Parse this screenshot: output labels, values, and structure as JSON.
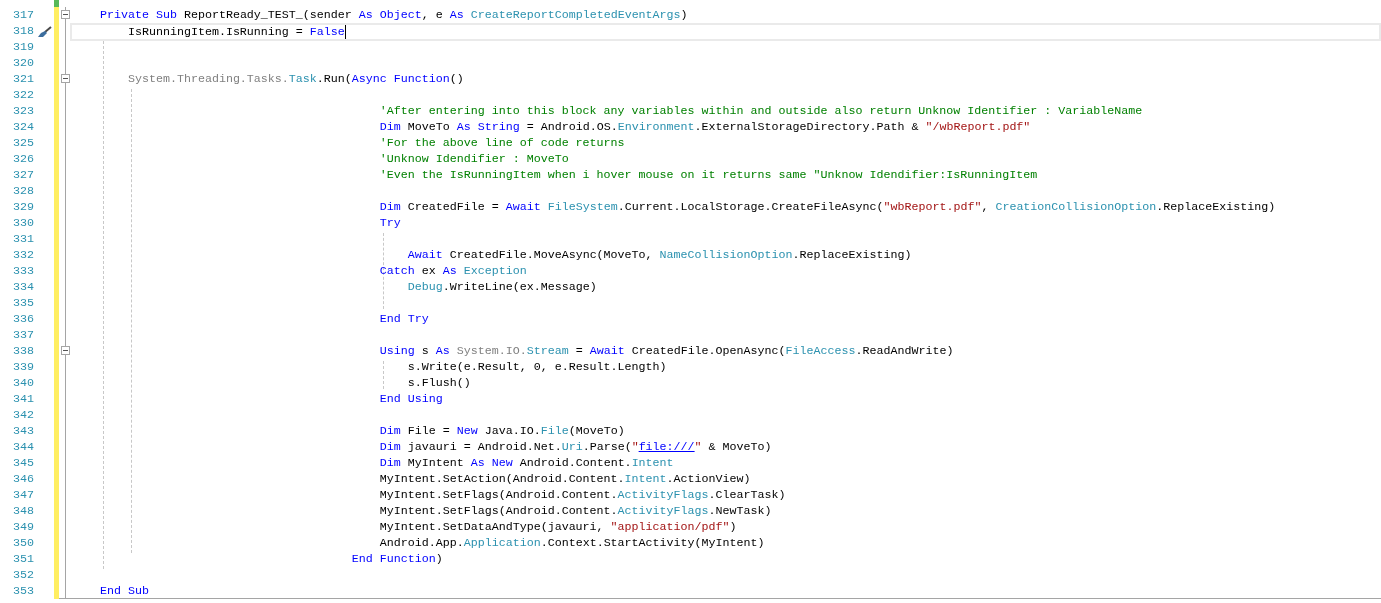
{
  "editor": {
    "lines": [
      {
        "color": "#57b857"
      },
      {
        "number": "317",
        "color": "#ffee62",
        "fold": {
          "expanded": true
        },
        "kind": "member",
        "tokens": [
          {
            "kind": "keyword",
            "text": "Private Sub"
          },
          {
            "kind": "plain",
            "text": " ReportReady_TEST_(sender "
          },
          {
            "kind": "keyword",
            "text": "As"
          },
          {
            "kind": "keyword",
            "text": " Object"
          },
          {
            "kind": "plain",
            "text": ", e "
          },
          {
            "kind": "keyword",
            "text": "As"
          },
          {
            "kind": "type",
            "text": " CreateReportCompletedEventArgs"
          },
          {
            "kind": "plain",
            "text": ")"
          }
        ]
      },
      {
        "number": "318",
        "color": "#ffee62",
        "current": true,
        "quick_actions": true,
        "kind": "statement",
        "tokens": [
          {
            "kind": "plain",
            "text": "IsRunningItem.IsRunning = "
          },
          {
            "kind": "keyword",
            "text": "False"
          }
        ]
      },
      {
        "number": "319",
        "color": "#ffee62"
      },
      {
        "number": "320",
        "color": "#ffee62"
      },
      {
        "number": "321",
        "color": "#ffee62",
        "fold": {
          "expanded": true
        },
        "kind": "statement",
        "tokens": [
          {
            "kind": "dim",
            "text": "System.Threading.Tasks."
          },
          {
            "kind": "type",
            "text": "Task"
          },
          {
            "kind": "plain",
            "text": ".Run("
          },
          {
            "kind": "keyword",
            "text": "Async Function"
          },
          {
            "kind": "plain",
            "text": "()"
          }
        ]
      },
      {
        "number": "322",
        "color": "#ffee62"
      },
      {
        "number": "323",
        "color": "#ffee62",
        "kind": "lambda",
        "tokens": [
          {
            "kind": "comment",
            "text": "'After entering into this block any variables within and outside also return Unknow Identifier : VariableName"
          }
        ]
      },
      {
        "number": "324",
        "color": "#ffee62",
        "kind": "lambda",
        "tokens": [
          {
            "kind": "keyword",
            "text": "Dim"
          },
          {
            "kind": "plain",
            "text": " MoveTo "
          },
          {
            "kind": "keyword",
            "text": "As String"
          },
          {
            "kind": "plain",
            "text": " = Android.OS."
          },
          {
            "kind": "type",
            "text": "Environment"
          },
          {
            "kind": "plain",
            "text": ".ExternalStorageDirectory.Path & "
          },
          {
            "kind": "string",
            "text": "\"/wbReport.pdf\""
          }
        ]
      },
      {
        "number": "325",
        "color": "#ffee62",
        "kind": "lambda",
        "tokens": [
          {
            "kind": "comment",
            "text": "'For the above line of code returns"
          }
        ]
      },
      {
        "number": "326",
        "color": "#ffee62",
        "kind": "lambda",
        "tokens": [
          {
            "kind": "comment",
            "text": "'Unknow Idendifier : MoveTo"
          }
        ]
      },
      {
        "number": "327",
        "color": "#ffee62",
        "kind": "lambda",
        "tokens": [
          {
            "kind": "comment",
            "text": "'Even the IsRunningItem when i hover mouse on it returns same \"Unknow Idendifier:IsRunningItem"
          }
        ]
      },
      {
        "number": "328",
        "color": "#ffee62"
      },
      {
        "number": "329",
        "color": "#ffee62",
        "kind": "lambda",
        "tokens": [
          {
            "kind": "keyword",
            "text": "Dim"
          },
          {
            "kind": "plain",
            "text": " CreatedFile = "
          },
          {
            "kind": "keyword",
            "text": "Await"
          },
          {
            "kind": "type",
            "text": " FileSystem"
          },
          {
            "kind": "plain",
            "text": ".Current.LocalStorage.CreateFileAsync("
          },
          {
            "kind": "string",
            "text": "\"wbReport.pdf\""
          },
          {
            "kind": "plain",
            "text": ", "
          },
          {
            "kind": "type",
            "text": "CreationCollisionOption"
          },
          {
            "kind": "plain",
            "text": ".ReplaceExisting)"
          }
        ]
      },
      {
        "number": "330",
        "color": "#ffee62",
        "kind": "lambda",
        "tokens": [
          {
            "kind": "keyword",
            "text": "Try"
          }
        ]
      },
      {
        "number": "331",
        "color": "#ffee62"
      },
      {
        "number": "332",
        "color": "#ffee62",
        "kind": "nested",
        "tokens": [
          {
            "kind": "keyword",
            "text": "Await"
          },
          {
            "kind": "plain",
            "text": " CreatedFile.MoveAsync(MoveTo, "
          },
          {
            "kind": "type",
            "text": "NameCollisionOption"
          },
          {
            "kind": "plain",
            "text": ".ReplaceExisting)"
          }
        ]
      },
      {
        "number": "333",
        "color": "#ffee62",
        "kind": "lambda",
        "tokens": [
          {
            "kind": "keyword",
            "text": "Catch"
          },
          {
            "kind": "plain",
            "text": " ex "
          },
          {
            "kind": "keyword",
            "text": "As"
          },
          {
            "kind": "type",
            "text": " Exception"
          }
        ]
      },
      {
        "number": "334",
        "color": "#ffee62",
        "kind": "nested",
        "tokens": [
          {
            "kind": "type",
            "text": "Debug"
          },
          {
            "kind": "plain",
            "text": ".WriteLine(ex.Message)"
          }
        ]
      },
      {
        "number": "335",
        "color": "#ffee62"
      },
      {
        "number": "336",
        "color": "#ffee62",
        "kind": "lambda",
        "tokens": [
          {
            "kind": "keyword",
            "text": "End Try"
          }
        ]
      },
      {
        "number": "337",
        "color": "#ffee62"
      },
      {
        "number": "338",
        "color": "#ffee62",
        "fold": {
          "expanded": true
        },
        "kind": "lambda",
        "tokens": [
          {
            "kind": "keyword",
            "text": "Using"
          },
          {
            "kind": "plain",
            "text": " s "
          },
          {
            "kind": "keyword",
            "text": "As"
          },
          {
            "kind": "dim",
            "text": " System.IO."
          },
          {
            "kind": "type",
            "text": "Stream"
          },
          {
            "kind": "plain",
            "text": " = "
          },
          {
            "kind": "keyword",
            "text": "Await"
          },
          {
            "kind": "plain",
            "text": " CreatedFile.OpenAsync("
          },
          {
            "kind": "type",
            "text": "FileAccess"
          },
          {
            "kind": "plain",
            "text": ".ReadAndWrite)"
          }
        ]
      },
      {
        "number": "339",
        "color": "#ffee62",
        "kind": "nested",
        "tokens": [
          {
            "kind": "plain",
            "text": "s.Write(e.Result, 0, e.Result.Length)"
          }
        ]
      },
      {
        "number": "340",
        "color": "#ffee62",
        "kind": "nested",
        "tokens": [
          {
            "kind": "plain",
            "text": "s.Flush()"
          }
        ]
      },
      {
        "number": "341",
        "color": "#ffee62",
        "kind": "lambda",
        "tokens": [
          {
            "kind": "keyword",
            "text": "End Using"
          }
        ]
      },
      {
        "number": "342",
        "color": "#ffee62"
      },
      {
        "number": "343",
        "color": "#ffee62",
        "kind": "lambda",
        "tokens": [
          {
            "kind": "keyword",
            "text": "Dim"
          },
          {
            "kind": "plain",
            "text": " File = "
          },
          {
            "kind": "keyword",
            "text": "New"
          },
          {
            "kind": "plain",
            "text": " Java.IO."
          },
          {
            "kind": "type",
            "text": "File"
          },
          {
            "kind": "plain",
            "text": "(MoveTo)"
          }
        ]
      },
      {
        "number": "344",
        "color": "#ffee62",
        "kind": "lambda",
        "tokens": [
          {
            "kind": "keyword",
            "text": "Dim"
          },
          {
            "kind": "plain",
            "text": " javauri = Android.Net."
          },
          {
            "kind": "type",
            "text": "Uri"
          },
          {
            "kind": "plain",
            "text": ".Parse("
          },
          {
            "kind": "string",
            "text": "\""
          },
          {
            "kind": "link",
            "text": "file:///"
          },
          {
            "kind": "string",
            "text": "\""
          },
          {
            "kind": "plain",
            "text": " & MoveTo)"
          }
        ]
      },
      {
        "number": "345",
        "color": "#ffee62",
        "kind": "lambda",
        "tokens": [
          {
            "kind": "keyword",
            "text": "Dim"
          },
          {
            "kind": "plain",
            "text": " MyIntent "
          },
          {
            "kind": "keyword",
            "text": "As New"
          },
          {
            "kind": "plain",
            "text": " Android.Content."
          },
          {
            "kind": "type",
            "text": "Intent"
          }
        ]
      },
      {
        "number": "346",
        "color": "#ffee62",
        "kind": "lambda",
        "tokens": [
          {
            "kind": "plain",
            "text": "MyIntent.SetAction(Android.Content."
          },
          {
            "kind": "type",
            "text": "Intent"
          },
          {
            "kind": "plain",
            "text": ".ActionView)"
          }
        ]
      },
      {
        "number": "347",
        "color": "#ffee62",
        "kind": "lambda",
        "tokens": [
          {
            "kind": "plain",
            "text": "MyIntent.SetFlags(Android.Content."
          },
          {
            "kind": "type",
            "text": "ActivityFlags"
          },
          {
            "kind": "plain",
            "text": ".ClearTask)"
          }
        ]
      },
      {
        "number": "348",
        "color": "#ffee62",
        "kind": "lambda",
        "tokens": [
          {
            "kind": "plain",
            "text": "MyIntent.SetFlags(Android.Content."
          },
          {
            "kind": "type",
            "text": "ActivityFlags"
          },
          {
            "kind": "plain",
            "text": ".NewTask)"
          }
        ]
      },
      {
        "number": "349",
        "color": "#ffee62",
        "kind": "lambda",
        "tokens": [
          {
            "kind": "plain",
            "text": "MyIntent.SetDataAndType(javauri, "
          },
          {
            "kind": "string",
            "text": "\"application/pdf\""
          },
          {
            "kind": "plain",
            "text": ")"
          }
        ]
      },
      {
        "number": "350",
        "color": "#ffee62",
        "kind": "lambda",
        "tokens": [
          {
            "kind": "plain",
            "text": "Android.App."
          },
          {
            "kind": "type",
            "text": "Application"
          },
          {
            "kind": "plain",
            "text": ".Context.StartActivity(MyIntent)"
          }
        ]
      },
      {
        "number": "351",
        "color": "#ffee62",
        "kind": "lambda_end",
        "tokens": [
          {
            "kind": "keyword",
            "text": "End Function"
          },
          {
            "kind": "plain",
            "text": ")"
          }
        ]
      },
      {
        "number": "352",
        "color": "#ffee62"
      },
      {
        "number": "353",
        "color": "#ffee62",
        "kind": "member",
        "tokens": [
          {
            "kind": "keyword",
            "text": "End Sub"
          }
        ]
      }
    ]
  }
}
